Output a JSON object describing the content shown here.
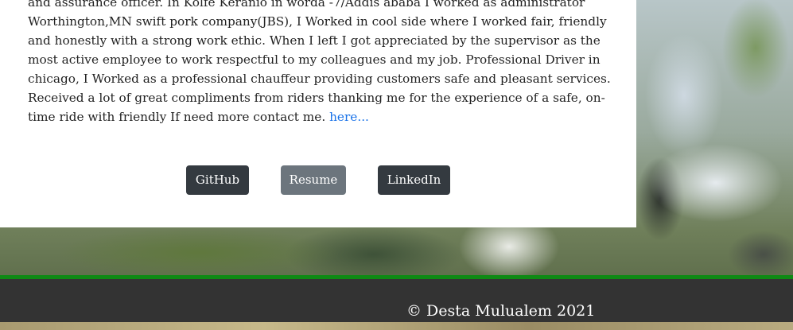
{
  "about": {
    "bio_text": "and assurance officer. In Kolfe Keranio in worda -7/Addis ababa I worked as administrator Worthington,MN swift pork company(JBS), I Worked in cool side where I worked fair, friendly and honestly with a strong work ethic. When I left I got appreciated by the supervisor as the most active employee to work respectful to my colleagues and my job. Professional Driver in chicago, I Worked as a professional chauffeur providing customers safe and pleasant services. Received a lot of great compliments from riders thanking me for the experience of a safe, on-time ride with friendly If need more contact me. ",
    "more_link_label": "here..."
  },
  "buttons": {
    "github_label": "GitHub",
    "resume_label": "Resume",
    "linkedin_label": "LinkedIn"
  },
  "footer": {
    "copyright": "© Desta Mulualem 2021"
  },
  "colors": {
    "footer_background": "#333333",
    "footer_accent": "#0e8a14",
    "dark_button": "#343a40",
    "secondary_button": "#6c757d",
    "link": "#1a73e8"
  }
}
